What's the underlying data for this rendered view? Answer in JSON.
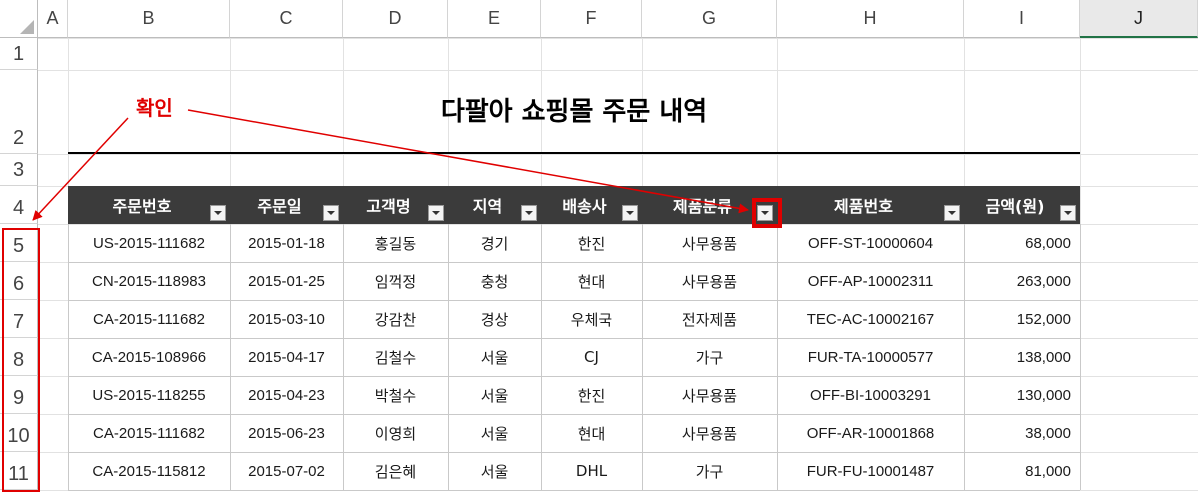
{
  "columns": [
    "A",
    "B",
    "C",
    "D",
    "E",
    "F",
    "G",
    "H",
    "I",
    "J"
  ],
  "rows": [
    "1",
    "2",
    "3",
    "4",
    "5",
    "6",
    "7",
    "8",
    "9",
    "10",
    "11"
  ],
  "title": "다팔아 쇼핑몰 주문 내역",
  "headers": [
    "주문번호",
    "주문일",
    "고객명",
    "지역",
    "배송사",
    "제품분류",
    "제품번호",
    "금액(원)"
  ],
  "records": [
    [
      "US-2015-111682",
      "2015-01-18",
      "홍길동",
      "경기",
      "한진",
      "사무용품",
      "OFF-ST-10000604",
      "68,000"
    ],
    [
      "CN-2015-118983",
      "2015-01-25",
      "임꺽정",
      "충청",
      "현대",
      "사무용품",
      "OFF-AP-10002311",
      "263,000"
    ],
    [
      "CA-2015-111682",
      "2015-03-10",
      "강감찬",
      "경상",
      "우체국",
      "전자제품",
      "TEC-AC-10002167",
      "152,000"
    ],
    [
      "CA-2015-108966",
      "2015-04-17",
      "김철수",
      "서울",
      "CJ",
      "가구",
      "FUR-TA-10000577",
      "138,000"
    ],
    [
      "US-2015-118255",
      "2015-04-23",
      "박철수",
      "서울",
      "한진",
      "사무용품",
      "OFF-BI-10003291",
      "130,000"
    ],
    [
      "CA-2015-111682",
      "2015-06-23",
      "이영희",
      "서울",
      "현대",
      "사무용품",
      "OFF-AR-10001868",
      "38,000"
    ],
    [
      "CA-2015-115812",
      "2015-07-02",
      "김은혜",
      "서울",
      "DHL",
      "가구",
      "FUR-FU-10001487",
      "81,000"
    ]
  ],
  "annotation": "확인",
  "selected_column": "J",
  "colors": {
    "header_bg": "#3b3b3b",
    "highlight": "#e00000",
    "selected_col_border": "#217346"
  }
}
